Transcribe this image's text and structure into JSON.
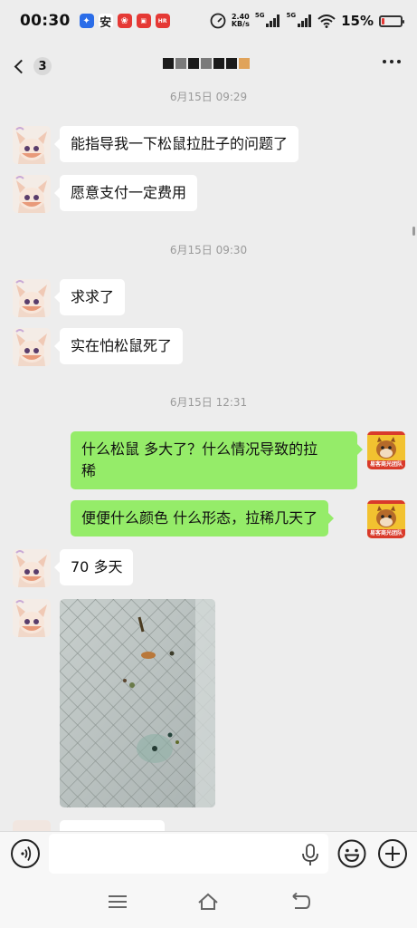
{
  "status_bar": {
    "time": "00:30",
    "net_speed_value": "2.40",
    "net_speed_unit": "KB/s",
    "signal_1_label": "5G",
    "signal_2_label": "5G",
    "battery_percent": "15%",
    "battery_level": 0.15,
    "battery_color": "#e53935",
    "notification_icons": [
      "app-blue-icon",
      "safety-icon",
      "red-app-icon",
      "red-badge-icon",
      "hr-app-icon"
    ]
  },
  "header": {
    "unread_count": "3"
  },
  "messages": [
    {
      "type": "time",
      "text": "6月15日 09:29"
    },
    {
      "type": "incoming",
      "text": "能指导我一下松鼠拉肚子的问题了"
    },
    {
      "type": "incoming",
      "text": "愿意支付一定费用"
    },
    {
      "type": "time",
      "text": "6月15日 09:30"
    },
    {
      "type": "incoming",
      "text": "求求了"
    },
    {
      "type": "incoming",
      "text": "实在怕松鼠死了"
    },
    {
      "type": "time",
      "text": "6月15日 12:31"
    },
    {
      "type": "outgoing",
      "text_line1": "什么松鼠  多大了？什么情况导致的拉",
      "text_line2": "稀"
    },
    {
      "type": "outgoing",
      "text": "便便什么颜色  什么形态，拉稀几天了"
    },
    {
      "type": "incoming",
      "text": "70 多天"
    },
    {
      "type": "incoming-image"
    }
  ],
  "self_avatar_caption": "易客商光团队",
  "colors": {
    "outgoing_bubble": "#95ec69",
    "incoming_bubble": "#ffffff",
    "background": "#ededed"
  },
  "input_bar": {
    "placeholder": ""
  },
  "nav": {
    "icons": [
      "menu-icon",
      "home-icon",
      "back-nav-icon"
    ]
  }
}
